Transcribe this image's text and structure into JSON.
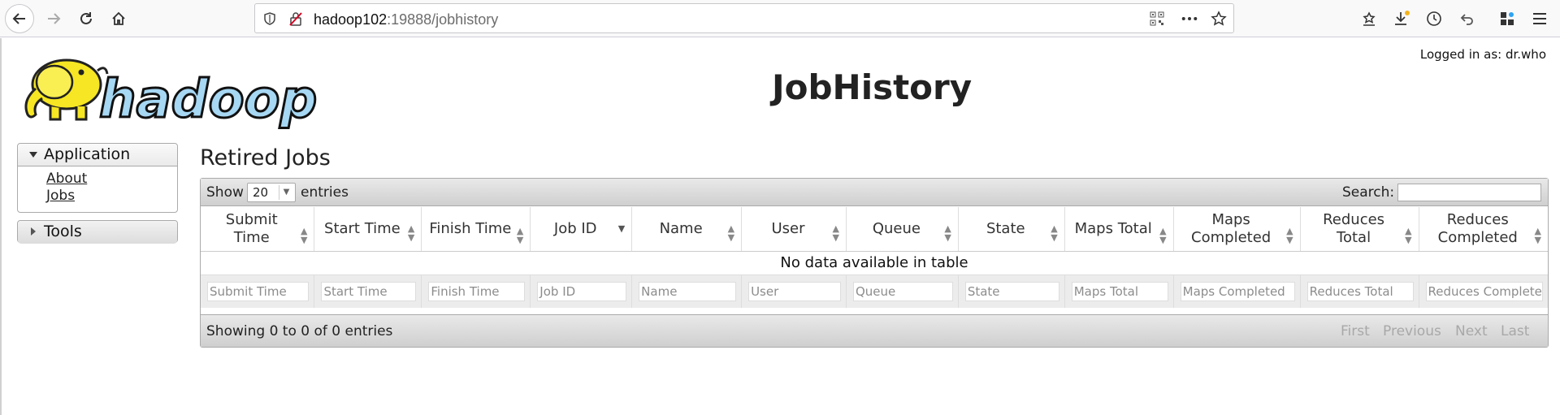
{
  "browser": {
    "url_host": "hadoop102",
    "url_rest": ":19888/jobhistory"
  },
  "header": {
    "logged_in": "Logged in as: dr.who",
    "title": "JobHistory",
    "logo_text": "hadoop"
  },
  "sidebar": {
    "application": {
      "label": "Application",
      "items": [
        {
          "label": "About"
        },
        {
          "label": "Jobs"
        }
      ]
    },
    "tools": {
      "label": "Tools"
    }
  },
  "main": {
    "section_title": "Retired Jobs",
    "show_label": "Show",
    "page_length": "20",
    "entries_label": "entries",
    "search_label": "Search:",
    "columns": [
      {
        "header_line1": "Submit Time",
        "header_line2": ""
      },
      {
        "header_line1": "Start Time",
        "header_line2": ""
      },
      {
        "header_line1": "Finish Time",
        "header_line2": ""
      },
      {
        "header_line1": "Job ID",
        "header_line2": ""
      },
      {
        "header_line1": "Name",
        "header_line2": ""
      },
      {
        "header_line1": "User",
        "header_line2": ""
      },
      {
        "header_line1": "Queue",
        "header_line2": ""
      },
      {
        "header_line1": "State",
        "header_line2": ""
      },
      {
        "header_line1": "Maps Total",
        "header_line2": ""
      },
      {
        "header_line1": "Maps",
        "header_line2": "Completed"
      },
      {
        "header_line1": "Reduces Total",
        "header_line2": ""
      },
      {
        "header_line1": "Reduces",
        "header_line2": "Completed"
      }
    ],
    "filters": [
      "Submit Time",
      "Start Time",
      "Finish Time",
      "Job ID",
      "Name",
      "User",
      "Queue",
      "State",
      "Maps Total",
      "Maps Completed",
      "Reduces Total",
      "Reduces Complete"
    ],
    "empty_message": "No data available in table",
    "info": "Showing 0 to 0 of 0 entries",
    "pagination": {
      "first": "First",
      "previous": "Previous",
      "next": "Next",
      "last": "Last"
    }
  }
}
